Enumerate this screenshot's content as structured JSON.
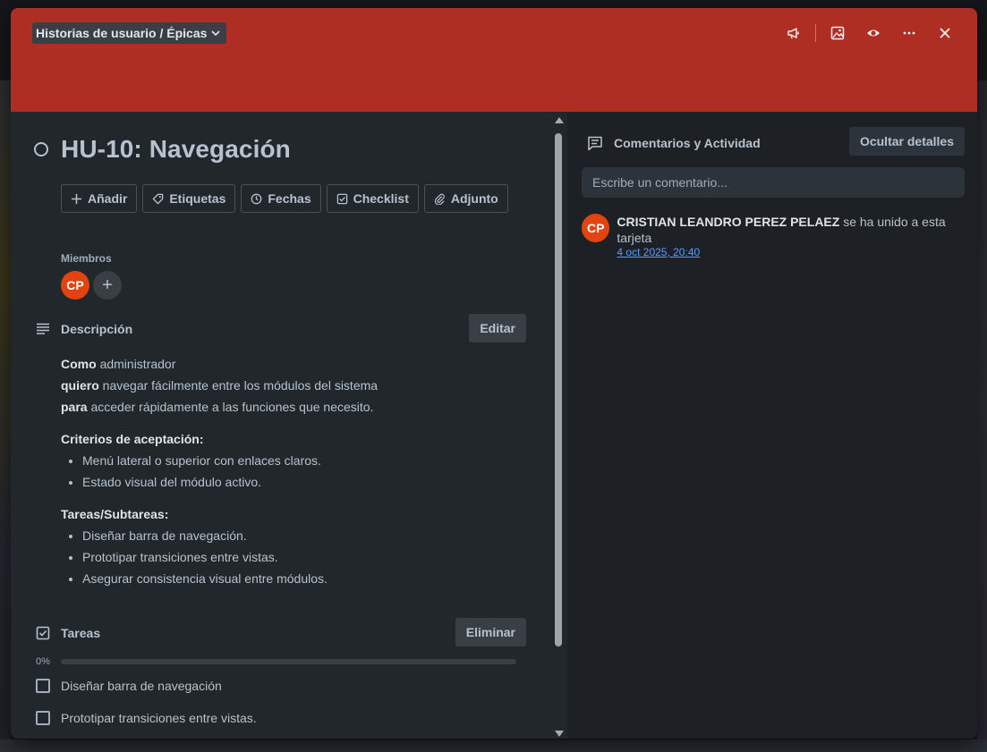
{
  "header": {
    "list_name": "Historias de usuario / Épicas",
    "cover_color": "#ae2e24",
    "actions": [
      "megaphone-icon",
      "image-icon",
      "eye-icon",
      "more-icon",
      "close-icon"
    ]
  },
  "card": {
    "title": "HU-10: Navegación",
    "action_buttons": [
      {
        "label": "Añadir",
        "icon": "plus-icon"
      },
      {
        "label": "Etiquetas",
        "icon": "tag-icon"
      },
      {
        "label": "Fechas",
        "icon": "clock-icon"
      },
      {
        "label": "Checklist",
        "icon": "checklist-icon"
      },
      {
        "label": "Adjunto",
        "icon": "paperclip-icon"
      }
    ],
    "members_label": "Miembros",
    "member_initials": "CP",
    "description": {
      "title": "Descripción",
      "edit_label": "Editar",
      "line1_bold": "Como",
      "line1_rest": "administrador",
      "line2_bold": "quiero",
      "line2_rest": "navegar fácilmente entre los módulos del sistema",
      "line3_bold": "para",
      "line3_rest": "acceder rápidamente a las funciones que necesito.",
      "criteria_title": "Criterios de aceptación:",
      "criteria": [
        "Menú lateral o superior con enlaces claros.",
        "Estado visual del módulo activo."
      ],
      "tasks_title": "Tareas/Subtareas:",
      "tasks": [
        "Diseñar barra de navegación.",
        "Prototipar transiciones entre vistas.",
        "Asegurar consistencia visual entre módulos."
      ]
    },
    "checklist": {
      "title": "Tareas",
      "delete_label": "Eliminar",
      "progress_label": "0%",
      "progress": 0,
      "items": [
        "Diseñar barra de navegación",
        "Prototipar transiciones entre vistas."
      ]
    }
  },
  "activity": {
    "title": "Comentarios y Actividad",
    "hide_label": "Ocultar detalles",
    "comment_placeholder": "Escribe un comentario...",
    "entry_user": "CRISTIAN LEANDRO PEREZ PELAEZ",
    "entry_action": "se ha unido a esta tarjeta",
    "entry_time": "4 oct 2025, 20:40",
    "entry_initials": "CP"
  }
}
